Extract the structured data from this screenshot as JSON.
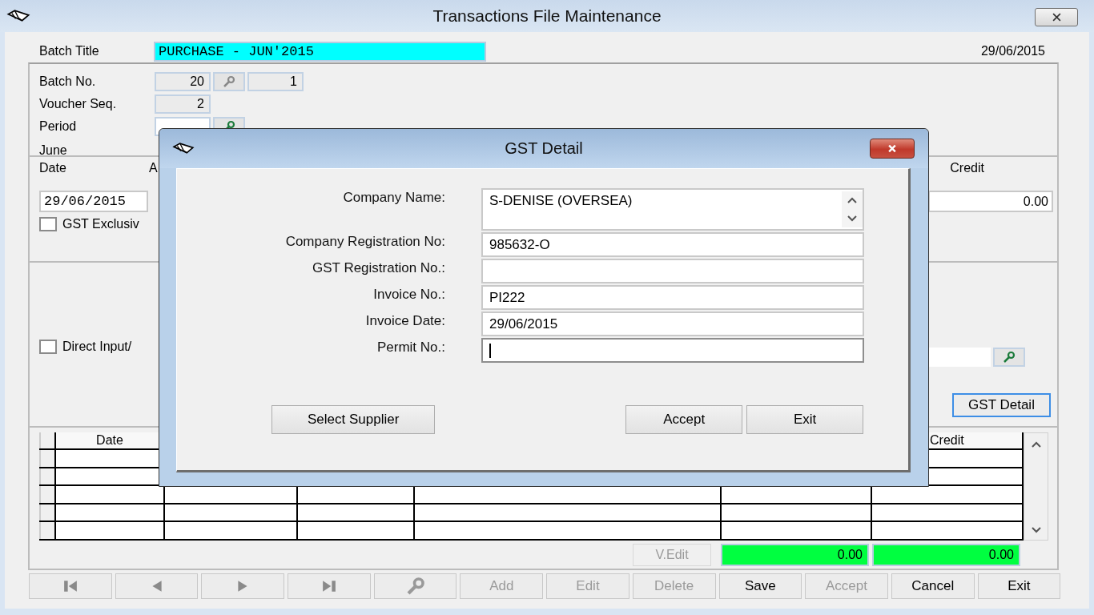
{
  "window": {
    "title": "Transactions File Maintenance",
    "date": "29/06/2015"
  },
  "batch_title": {
    "label": "Batch Title",
    "value": "PURCHASE - JUN'2015"
  },
  "batch": {
    "label": "Batch No.",
    "number": "20",
    "sub_number": "1"
  },
  "voucher_seq": {
    "label": "Voucher Seq.",
    "value": "2"
  },
  "period": {
    "label": "Period"
  },
  "month": "June",
  "entry": {
    "date_label": "Date",
    "column_label": "A",
    "credit_label": "Credit",
    "date": "29/06/2015",
    "credit": "0.00"
  },
  "options": [
    {
      "label": "GST Exclusiv",
      "checked": false
    },
    {
      "label": "Direct Input/",
      "checked": false
    }
  ],
  "gst_detail_button": "GST Detail",
  "table": {
    "date_heading": "Date",
    "credit_heading": "Credit"
  },
  "v_edit": {
    "label": "V.Edit",
    "disabled": true
  },
  "totals": [
    "0.00",
    "0.00"
  ],
  "toolbar": [
    {
      "kind": "first",
      "disabled": true
    },
    {
      "kind": "previous",
      "disabled": true
    },
    {
      "kind": "next",
      "disabled": true
    },
    {
      "kind": "last",
      "disabled": true
    },
    {
      "kind": "lookup",
      "disabled": true
    },
    {
      "kind": "text",
      "label": "Add",
      "disabled": true
    },
    {
      "kind": "text",
      "label": "Edit",
      "disabled": true
    },
    {
      "kind": "text",
      "label": "Delete",
      "disabled": true
    },
    {
      "kind": "text",
      "label": "Save",
      "disabled": false
    },
    {
      "kind": "text",
      "label": "Accept",
      "disabled": true
    },
    {
      "kind": "text",
      "label": "Cancel",
      "disabled": false
    },
    {
      "kind": "text",
      "label": "Exit",
      "disabled": false
    }
  ],
  "dialog": {
    "title": "GST Detail",
    "fields": [
      {
        "label": "Company Name:",
        "value": "S-DENISE (OVERSEA)",
        "kind": "multiline",
        "focused": false
      },
      {
        "label": "Company Registration No:",
        "value": "985632-O",
        "kind": "text",
        "focused": false
      },
      {
        "label": "GST Registration No.:",
        "kind": "text",
        "focused": false
      },
      {
        "label": "Invoice No.:",
        "value": "PI222",
        "kind": "text",
        "focused": false
      },
      {
        "label": "Invoice Date:",
        "value": "29/06/2015",
        "kind": "text",
        "focused": false
      },
      {
        "label": "Permit No.:",
        "kind": "text",
        "focused": true
      }
    ],
    "select_button": "Select Supplier",
    "buttons": [
      "Accept",
      "Exit"
    ]
  }
}
